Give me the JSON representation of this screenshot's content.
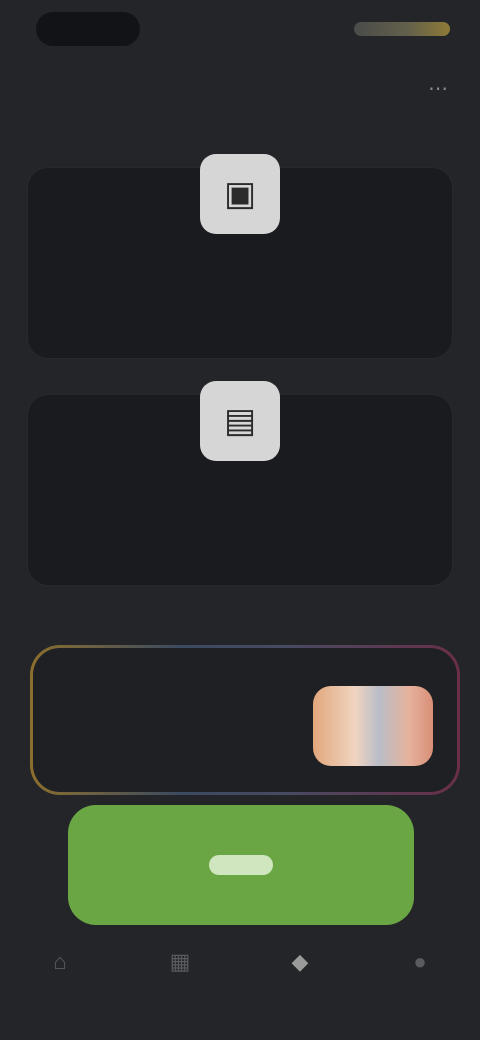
{
  "status_bar": {
    "time": "",
    "indicators": ""
  },
  "header": {
    "title": "",
    "action_icon": "more-icon"
  },
  "cards": [
    {
      "title": "",
      "subtitle": "",
      "icon": "photo-icon"
    },
    {
      "title": "",
      "subtitle": "",
      "icon": "gallery-icon"
    }
  ],
  "promo": {
    "text": ""
  },
  "cta": {
    "label": "",
    "color": "#6ba644"
  },
  "bottom_nav": {
    "items": [
      {
        "icon": "home-icon"
      },
      {
        "icon": "grid-icon"
      },
      {
        "icon": "tools-icon",
        "active": true
      },
      {
        "icon": "profile-icon"
      }
    ]
  }
}
